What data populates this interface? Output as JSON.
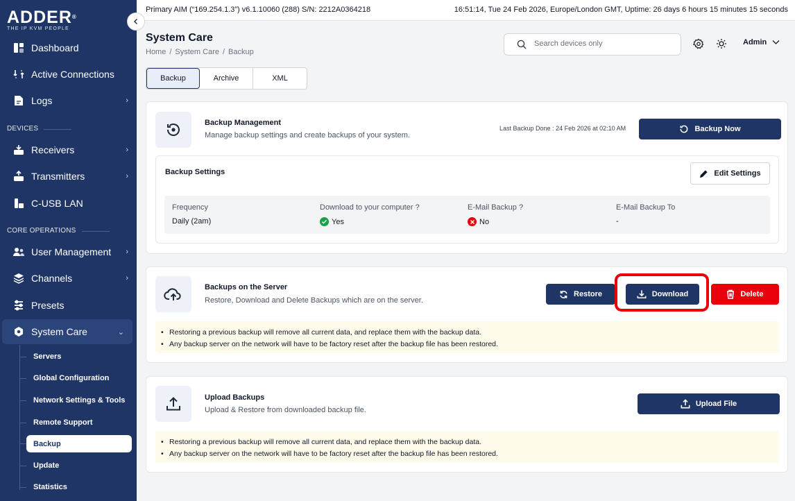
{
  "brand": {
    "name": "ADDER",
    "reg": "®",
    "tagline": "THE IP KVM PEOPLE"
  },
  "topbar": {
    "left": "Primary AIM (“169.254.1.3”) v6.1.10060 (288) S/N: 2212A0364218",
    "right": "16:51:14, Tue 24 Feb 2026, Europe/London GMT, Uptime: 26 days 6 hours 15 minutes 15 seconds"
  },
  "sidebar": {
    "items": [
      {
        "label": "Dashboard",
        "icon": "dashboard-icon"
      },
      {
        "label": "Active Connections",
        "icon": "connections-icon"
      },
      {
        "label": "Logs",
        "icon": "logs-icon",
        "chevron": "›"
      }
    ],
    "devices_label": "DEVICES",
    "devices": [
      {
        "label": "Receivers",
        "icon": "receiver-icon",
        "chevron": "›"
      },
      {
        "label": "Transmitters",
        "icon": "transmitter-icon",
        "chevron": "›"
      },
      {
        "label": "C-USB LAN",
        "icon": "usb-lan-icon"
      }
    ],
    "core_label": "CORE OPERATIONS",
    "core": [
      {
        "label": "User Management",
        "icon": "users-icon",
        "chevron": "›"
      },
      {
        "label": "Channels",
        "icon": "channels-icon",
        "chevron": "›"
      },
      {
        "label": "Presets",
        "icon": "presets-icon"
      },
      {
        "label": "System Care",
        "icon": "system-care-icon",
        "chevron": "⌄"
      }
    ],
    "system_care_sub": [
      "Servers",
      "Global Configuration",
      "Network Settings & Tools",
      "Remote Support",
      "Backup",
      "Update",
      "Statistics"
    ]
  },
  "header": {
    "title": "System Care",
    "breadcrumb": [
      "Home",
      "/",
      "System Care",
      "/",
      "Backup"
    ],
    "search_placeholder": "Search devices only",
    "user": "Admin"
  },
  "tabs": [
    "Backup",
    "Archive",
    "XML"
  ],
  "backup_management": {
    "title": "Backup Management",
    "desc": "Manage backup settings and create backups of your system.",
    "last_backup_label": "Last Backup Done :",
    "last_backup_value": "24 Feb 2026 at 02:10 AM",
    "backup_now": "Backup Now",
    "settings": {
      "title": "Backup Settings",
      "edit": "Edit Settings",
      "columns": [
        {
          "header": "Frequency",
          "value": "Daily (2am)"
        },
        {
          "header": "Download to your computer ?",
          "value": "Yes",
          "status": "yes"
        },
        {
          "header": "E-Mail Backup ?",
          "value": "No",
          "status": "no"
        },
        {
          "header": "E-Mail Backup To",
          "value": "-"
        }
      ]
    }
  },
  "server_backups": {
    "title": "Backups on the Server",
    "desc": "Restore, Download and Delete Backups which are on the server.",
    "restore": "Restore",
    "download": "Download",
    "delete": "Delete",
    "notes": [
      "Restoring a previous backup will remove all current data, and replace them with the backup data.",
      "Any backup server on the network will have to be factory reset after the backup file has been restored."
    ]
  },
  "upload": {
    "title": "Upload Backups",
    "desc": "Upload & Restore from downloaded backup file.",
    "button": "Upload File",
    "notes": [
      "Restoring a previous backup will remove all current data, and replace them with the backup data.",
      "Any backup server on the network will have to be factory reset after the backup file has been restored."
    ]
  },
  "colors": {
    "sidebar": "#1e3566",
    "primary": "#1e3566",
    "danger": "#e8000b",
    "success": "#16a34a",
    "notice": "#fefbea"
  }
}
